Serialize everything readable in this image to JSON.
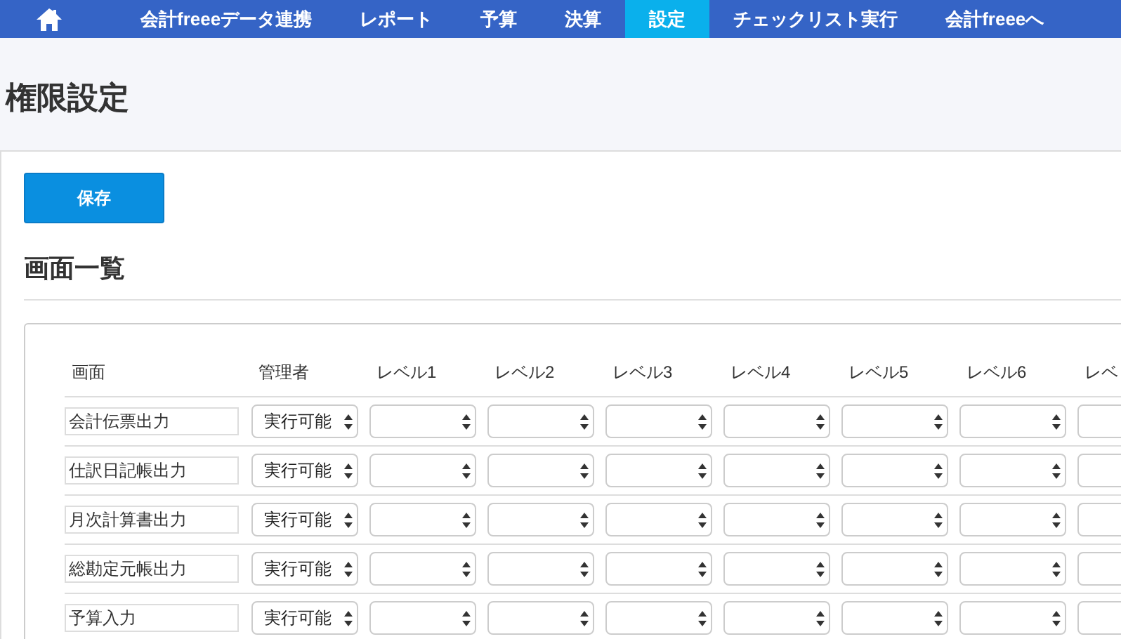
{
  "nav": {
    "items": [
      {
        "label": "会計freeeデータ連携",
        "selected": false
      },
      {
        "label": "レポート",
        "selected": false
      },
      {
        "label": "予算",
        "selected": false
      },
      {
        "label": "決算",
        "selected": false
      },
      {
        "label": "設定",
        "selected": true
      },
      {
        "label": "チェックリスト実行",
        "selected": false
      },
      {
        "label": "会計freeeへ",
        "selected": false
      }
    ]
  },
  "page_title": "権限設定",
  "save_button": "保存",
  "section_title": "画面一覧",
  "table": {
    "columns": [
      {
        "label": "画面",
        "kind": "name"
      },
      {
        "label": "管理者",
        "kind": "admin"
      },
      {
        "label": "レベル1",
        "kind": "level"
      },
      {
        "label": "レベル2",
        "kind": "level"
      },
      {
        "label": "レベル3",
        "kind": "level"
      },
      {
        "label": "レベル4",
        "kind": "level"
      },
      {
        "label": "レベル5",
        "kind": "level"
      },
      {
        "label": "レベル6",
        "kind": "level"
      },
      {
        "label": "レベ",
        "kind": "level"
      }
    ],
    "rows": [
      {
        "screen": "会計伝票出力",
        "admin": "実行可能"
      },
      {
        "screen": "仕訳日記帳出力",
        "admin": "実行可能"
      },
      {
        "screen": "月次計算書出力",
        "admin": "実行可能"
      },
      {
        "screen": "総勘定元帳出力",
        "admin": "実行可能"
      },
      {
        "screen": "予算入力",
        "admin": "実行可能"
      }
    ]
  }
}
